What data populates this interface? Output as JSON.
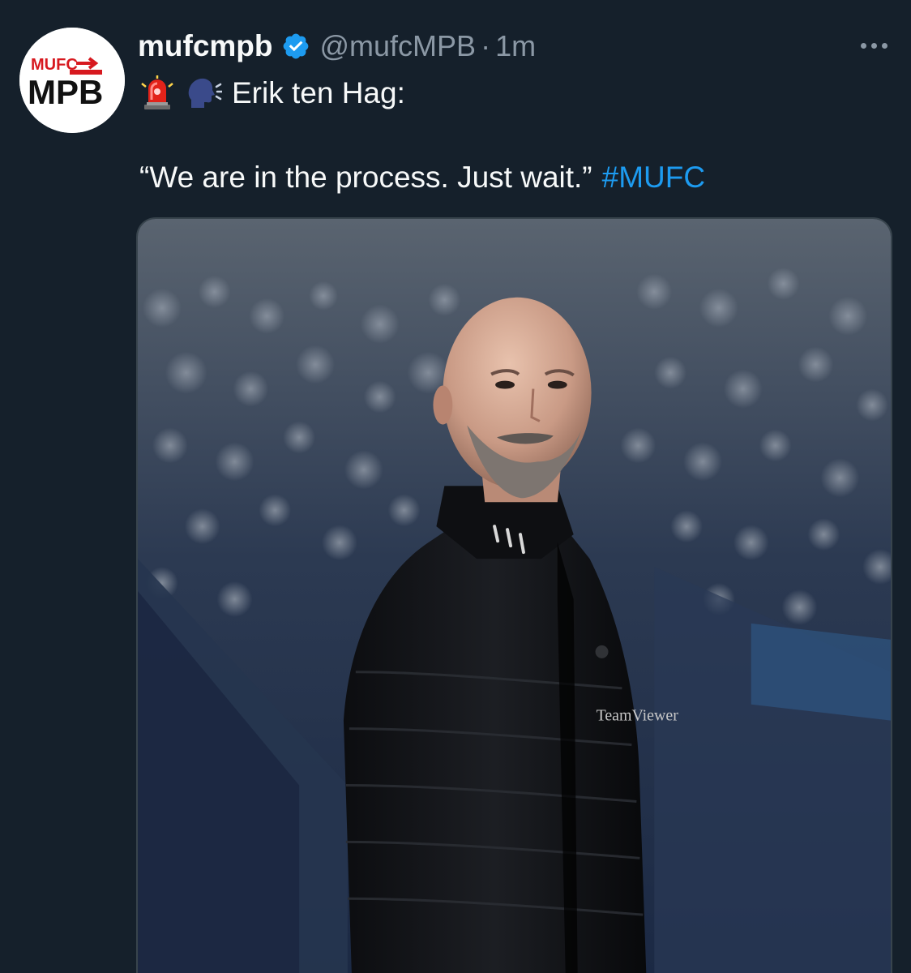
{
  "tweet": {
    "author": {
      "display_name": "mufcmpb",
      "handle": "@mufcMPB",
      "verified": true,
      "avatar_text_top": "MUFC",
      "avatar_text_bottom": "MPB"
    },
    "separator": "·",
    "timestamp": "1m",
    "text_line1": "Erik ten Hag:",
    "text_line2": "“We are in the process. Just wait.”",
    "hashtag": "#MUFC",
    "emojis": [
      "police-light-emoji",
      "speaking-head-emoji"
    ],
    "media": {
      "alt": "Photo of Erik ten Hag in a black training vest in a stadium",
      "vest_logo_text": "TeamViewer"
    }
  },
  "colors": {
    "background": "#15202b",
    "text_primary": "#f7f9f9",
    "text_secondary": "#8b98a5",
    "link": "#1d9bf0",
    "verified_blue": "#1d9bf0",
    "brand_red": "#d7191f"
  },
  "icons": {
    "verified": "verified-badge-icon",
    "more": "more-horizontal-icon"
  }
}
